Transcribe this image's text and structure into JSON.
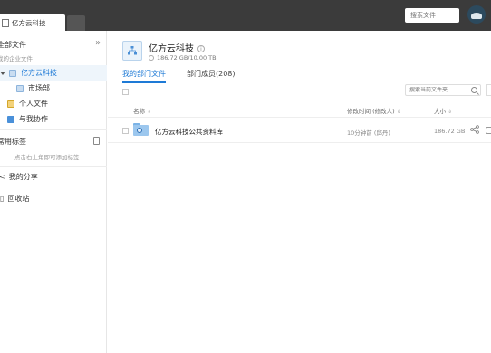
{
  "topbar": {
    "tab_label": "亿方云科技",
    "search_placeholder": "搜索文件"
  },
  "sidebar": {
    "all_files": "全部文件",
    "enterprise_files": "我的企业文件",
    "company": "亿方云科技",
    "market_dept": "市场部",
    "personal_files": "个人文件",
    "collab": "与我协作",
    "tags_title": "常用标签",
    "tags_hint": "点击右上角即可添加标签",
    "my_shares": "我的分享",
    "recycle_bin": "回收站"
  },
  "main": {
    "dept_name": "亿方云科技",
    "quota": "186.72 GB/10.00 TB",
    "tabs": [
      {
        "label": "我的部门文件",
        "active": true
      },
      {
        "label": "部门成员(208)",
        "active": false
      }
    ],
    "search_placeholder": "搜索当前文件夹",
    "columns": {
      "name": "名称",
      "modified": "修改时间 (修改人)",
      "size": "大小"
    },
    "files": [
      {
        "name": "亿方云科技公共资料库",
        "modified": "10分钟前 (邱丹)",
        "size": "186.72 GB"
      }
    ]
  },
  "colors": {
    "topbar": "#3b3b3b",
    "accent": "#1e7ad6",
    "selected_bg": "#eef5fb"
  }
}
